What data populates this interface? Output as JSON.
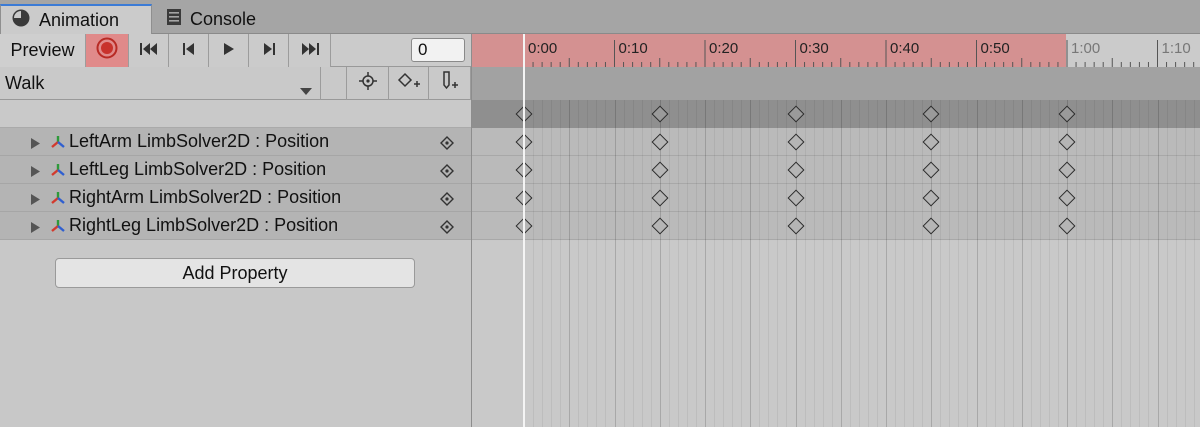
{
  "tabs": [
    {
      "label": "Animation",
      "icon": "clock-icon",
      "active": true
    },
    {
      "label": "Console",
      "icon": "list-icon",
      "active": false
    }
  ],
  "toolbar": {
    "preview_label": "Preview",
    "frame_value": "0",
    "record_color": "#c8322c",
    "record_bg": "#e08a8a"
  },
  "clip": {
    "name": "Walk"
  },
  "properties": [
    {
      "label": "LeftArm LimbSolver2D : Position"
    },
    {
      "label": "LeftLeg LimbSolver2D : Position"
    },
    {
      "label": "RightArm LimbSolver2D : Position"
    },
    {
      "label": "RightLeg LimbSolver2D : Position"
    }
  ],
  "add_property_label": "Add Property",
  "timeline": {
    "tick_labels": [
      "0:00",
      "0:10",
      "0:20",
      "0:30",
      "0:40",
      "0:50",
      "1:00",
      "1:10"
    ],
    "keyframe_frames": [
      0,
      15,
      30,
      45,
      60
    ],
    "clip_length_frames": 60,
    "playhead_frame": 0,
    "range_color": "#d49191"
  }
}
